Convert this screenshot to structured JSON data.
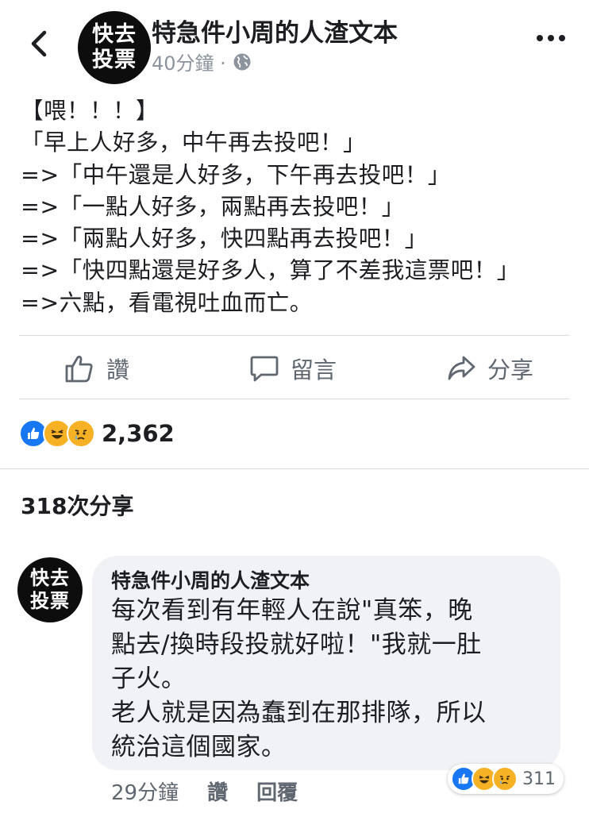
{
  "header": {
    "avatar_line1": "快去",
    "avatar_line2": "投票",
    "page_name": "特急件小周的人渣文本",
    "time": "40分鐘 ·",
    "privacy_icon": "globe-icon"
  },
  "post": {
    "text": "【喂！！！】\n「早上人好多，中午再去投吧！」\n=>「中午還是人好多，下午再去投吧！」\n=>「一點人好多，兩點再去投吧！」\n=>「兩點人好多，快四點再去投吧！」\n=>「快四點還是好多人，算了不差我這票吧！」\n=>六點，看電視吐血而亡。"
  },
  "actions": {
    "like": "讚",
    "comment": "留言",
    "share": "分享"
  },
  "stats": {
    "reactions_count": "2,362",
    "reaction_icons": [
      "like-icon",
      "haha-icon",
      "sad-icon"
    ],
    "shares": "318次分享"
  },
  "comment": {
    "avatar_line1": "快去",
    "avatar_line2": "投票",
    "author": "特急件小周的人渣文本",
    "text": "每次看到有年輕人在說\"真笨，晚\n點去/換時段投就好啦！\"我就一肚\n子火。\n老人就是因為蠢到在那排隊，所以\n統治這個國家。",
    "time": "29分鐘",
    "like": "讚",
    "reply": "回覆",
    "reactions_count": "311"
  },
  "colors": {
    "like_blue": "#1877f2",
    "emoji_yellow": "#f7b125",
    "text_gray": "#606770",
    "bubble_bg": "#f0f2f5"
  }
}
